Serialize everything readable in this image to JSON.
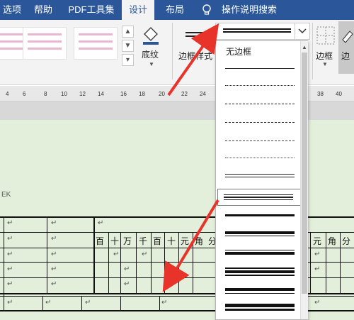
{
  "ribbon": {
    "tabs": [
      "选项",
      "帮助",
      "PDF工具集",
      "设计",
      "布局",
      "操作说明搜索"
    ],
    "active_tab": "设计",
    "shading_label": "底纹",
    "border_styles_label": "边框样式",
    "borders_label": "边框",
    "accent_color": "#2b579a"
  },
  "ruler": {
    "ticks": [
      "4",
      "6",
      "8",
      "10",
      "12",
      "14",
      "16",
      "18",
      "20",
      "22",
      "24",
      "38",
      "40"
    ]
  },
  "border_style_dropdown": {
    "none_label": "无边框",
    "selected_index": 7,
    "options_count": 14
  },
  "document": {
    "header_cells": [
      "百",
      "十",
      "万",
      "千",
      "百",
      "十",
      "元",
      "角",
      "分",
      "元",
      "角",
      "分"
    ],
    "paragraph_mark": "↵"
  }
}
